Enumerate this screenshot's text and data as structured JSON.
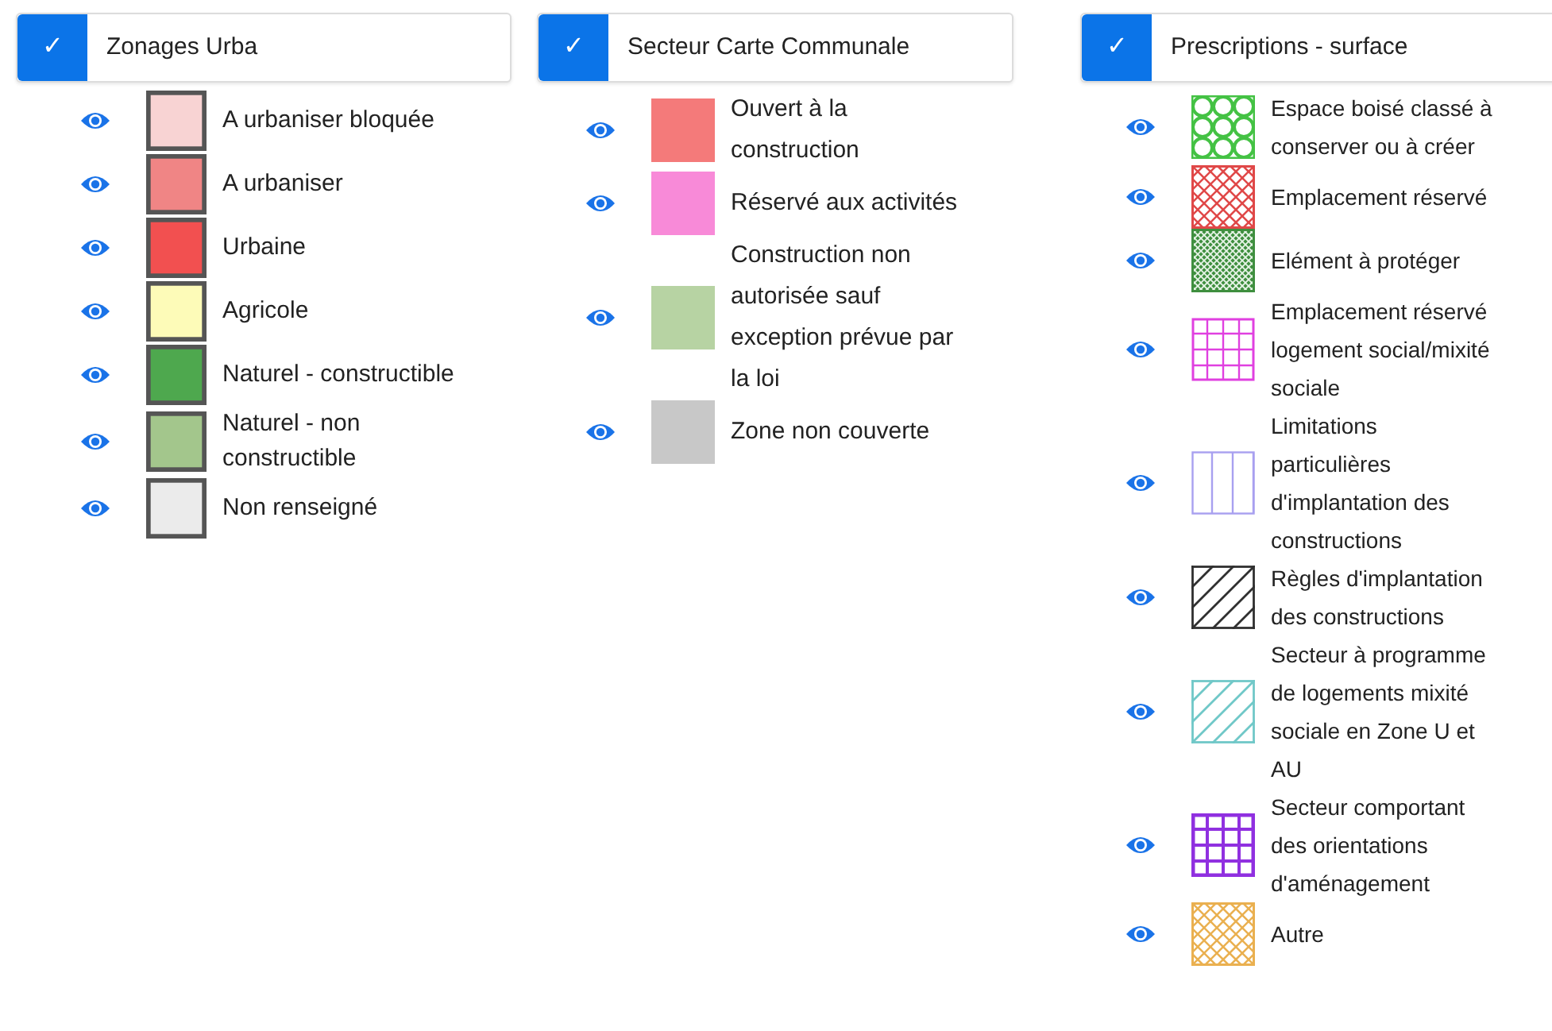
{
  "legends": [
    {
      "title": "Zonages Urba",
      "checked": true,
      "check": "✓",
      "items": [
        {
          "label": "A urbaniser bloquée",
          "kind": "fill",
          "color": "#f8d3d3",
          "outlined": true,
          "visible": true
        },
        {
          "label": "A urbaniser",
          "kind": "fill",
          "color": "#f08585",
          "outlined": true,
          "visible": true
        },
        {
          "label": "Urbaine",
          "kind": "fill",
          "color": "#f25050",
          "outlined": true,
          "visible": true
        },
        {
          "label": "Agricole",
          "kind": "fill",
          "color": "#fdfbb8",
          "outlined": true,
          "visible": true
        },
        {
          "label": "Naturel - constructible",
          "kind": "fill",
          "color": "#4ea84e",
          "outlined": true,
          "visible": true
        },
        {
          "label": "Naturel - non constructible",
          "kind": "fill",
          "color": "#a3c68c",
          "outlined": true,
          "visible": true
        },
        {
          "label": "Non renseigné",
          "kind": "fill",
          "color": "#ebebeb",
          "outlined": true,
          "visible": true
        }
      ]
    },
    {
      "title": "Secteur Carte Communale",
      "checked": true,
      "check": "✓",
      "items": [
        {
          "label": "Ouvert à la construction",
          "kind": "fill",
          "color": "#f47a7a",
          "outlined": false,
          "visible": true
        },
        {
          "label": "Réservé aux activités",
          "kind": "fill",
          "color": "#f88ad8",
          "outlined": false,
          "visible": true
        },
        {
          "label": "Construction non autorisée sauf exception prévue par la loi",
          "kind": "fill",
          "color": "#b7d3a3",
          "outlined": false,
          "visible": true
        },
        {
          "label": "Zone non couverte",
          "kind": "fill",
          "color": "#c8c8c8",
          "outlined": false,
          "visible": true
        }
      ]
    },
    {
      "title": "Prescriptions - surface",
      "checked": true,
      "check": "✓",
      "items": [
        {
          "label": "Espace boisé classé à conserver ou à créer",
          "kind": "circles",
          "color": "#44c244",
          "visible": true
        },
        {
          "label": "Emplacement réservé",
          "kind": "crosshatch",
          "color": "#e04848",
          "visible": true
        },
        {
          "label": "Elément à protéger",
          "kind": "dense-hatch",
          "color": "#3f8f3f",
          "visible": true
        },
        {
          "label": "Emplacement réservé logement social/mixité sociale",
          "kind": "grid",
          "color": "#e040e0",
          "visible": true
        },
        {
          "label": "Limitations particulières d'implantation des constructions",
          "kind": "vertical-lines",
          "color": "#a8a0f0",
          "visible": true
        },
        {
          "label": "Règles d'implantation des constructions",
          "kind": "diagonal-lines",
          "color": "#303030",
          "visible": true
        },
        {
          "label": "Secteur à programme de logements mixité sociale en Zone U et AU",
          "kind": "diagonal-lines",
          "color": "#70c8c8",
          "visible": true
        },
        {
          "label": "Secteur comportant des orientations d'aménagement",
          "kind": "bold-grid",
          "color": "#9030e0",
          "visible": true
        },
        {
          "label": "Autre",
          "kind": "crosshatch",
          "color": "#eab050",
          "visible": true
        }
      ]
    }
  ]
}
